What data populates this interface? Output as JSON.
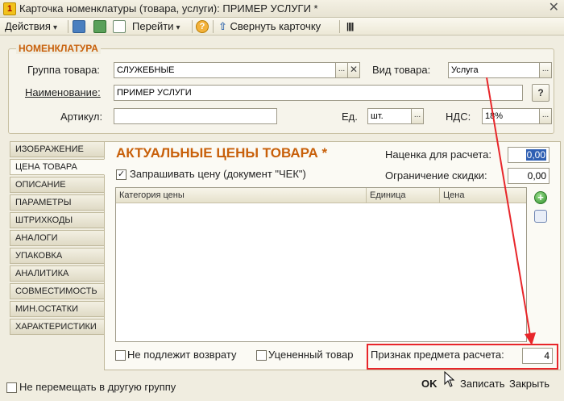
{
  "window": {
    "title": "Карточка номенклатуры (товара, услуги): ПРИМЕР УСЛУГИ *",
    "close_glyph": "✕"
  },
  "toolbar": {
    "actions_label": "Действия",
    "goto_label": "Перейти",
    "collapse_label": "Свернуть карточку"
  },
  "nomenclature": {
    "group_title": "НОМЕНКЛАТУРА",
    "group_label": "Группа товара:",
    "group_value": "СЛУЖЕБНЫЕ",
    "kind_label": "Вид товара:",
    "kind_value": "Услуга",
    "name_label": "Наименование:",
    "name_value": "ПРИМЕР УСЛУГИ",
    "article_label": "Артикул:",
    "article_value": "",
    "unit_label": "Ед.",
    "unit_value": "шт.",
    "vat_label": "НДС:",
    "vat_value": "18%",
    "help_glyph": "?"
  },
  "tabs": [
    {
      "label": "ИЗОБРАЖЕНИЕ"
    },
    {
      "label": "ЦЕНА ТОВАРА"
    },
    {
      "label": "ОПИСАНИЕ"
    },
    {
      "label": "ПАРАМЕТРЫ"
    },
    {
      "label": "ШТРИХКОДЫ"
    },
    {
      "label": "АНАЛОГИ"
    },
    {
      "label": "УПАКОВКА"
    },
    {
      "label": "АНАЛИТИКА"
    },
    {
      "label": "СОВМЕСТИМОСТЬ"
    },
    {
      "label": "МИН.ОСТАТКИ"
    },
    {
      "label": "ХАРАКТЕРИСТИКИ"
    }
  ],
  "price_tab": {
    "title": "АКТУАЛЬНЫЕ ЦЕНЫ ТОВАРА *",
    "markup_label": "Наценка для расчета:",
    "markup_value": "0,00",
    "discount_label": "Ограничение скидки:",
    "discount_value": "0,00",
    "ask_price_label": "Запрашивать цену (документ \"ЧЕК\")",
    "ask_price_checked": true,
    "columns": [
      "Категория цены",
      "Единица",
      "Цена"
    ],
    "no_return_label": "Не подлежит возврату",
    "discounted_label": "Уцененный товар",
    "subject_label": "Признак предмета расчета:",
    "subject_value": "4"
  },
  "footer": {
    "no_move_label": "Не перемещать в другую группу",
    "ok_label": "OK",
    "save_label": "Записать",
    "close_label": "Закрыть"
  },
  "colors": {
    "accent": "#c8600a",
    "annotation": "#e8262a",
    "window_bg": "#f0ede0"
  }
}
